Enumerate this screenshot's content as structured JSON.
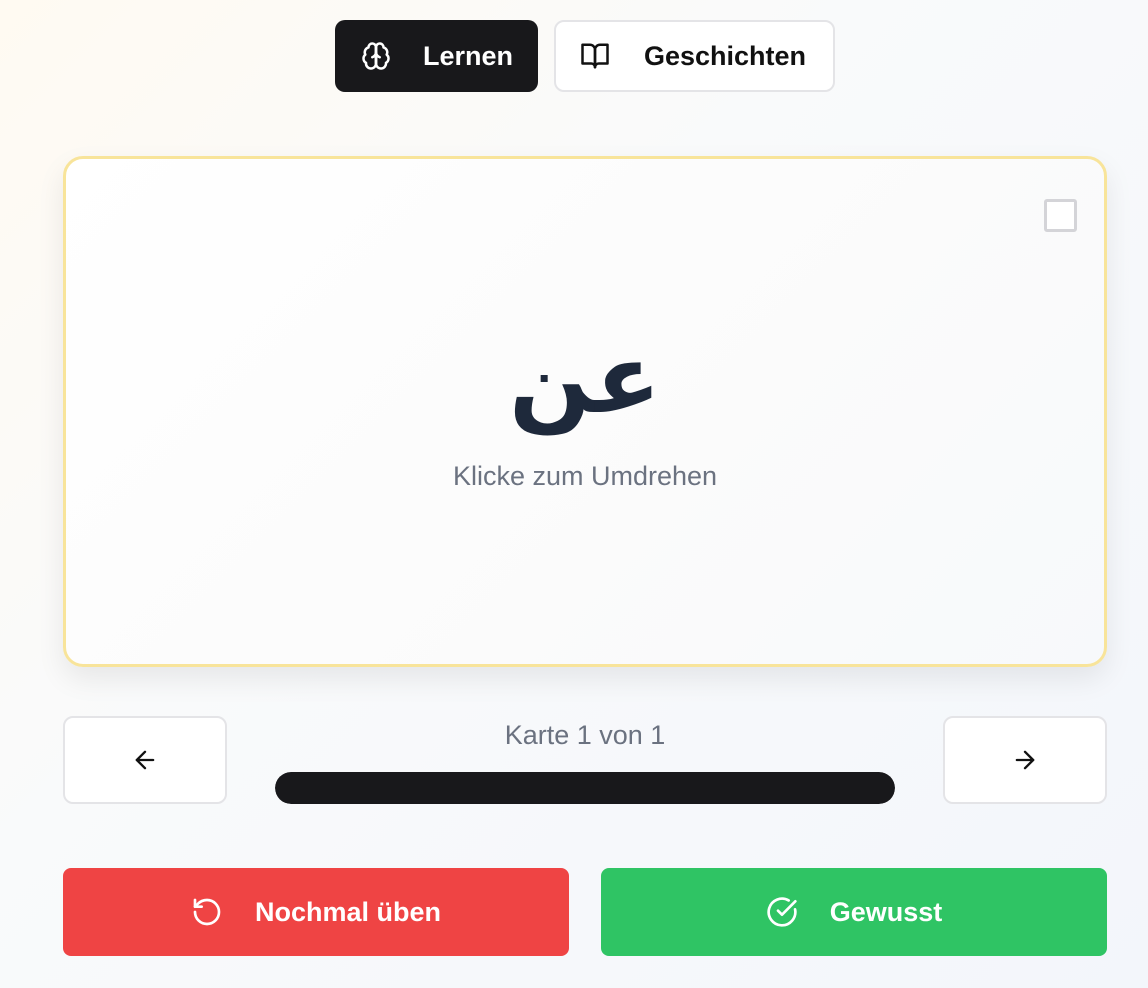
{
  "tabs": [
    {
      "label": "Lernen",
      "icon": "brain-icon",
      "active": true
    },
    {
      "label": "Geschichten",
      "icon": "book-open-icon",
      "active": false
    }
  ],
  "card": {
    "word": "عن",
    "hint": "Klicke zum Umdrehen",
    "checked": false
  },
  "navigation": {
    "prev_icon": "arrow-left-icon",
    "next_icon": "arrow-right-icon",
    "counter": "Karte 1 von 1",
    "progress": 1.0
  },
  "actions": {
    "again_label": "Nochmal üben",
    "again_icon": "rotate-ccw-icon",
    "known_label": "Gewusst",
    "known_icon": "check-circle-icon"
  },
  "colors": {
    "active_tab": "#18181b",
    "card_border": "#f8e49a",
    "again": "#ef4444",
    "known": "#2fc464",
    "progress_fill": "#18181b"
  }
}
